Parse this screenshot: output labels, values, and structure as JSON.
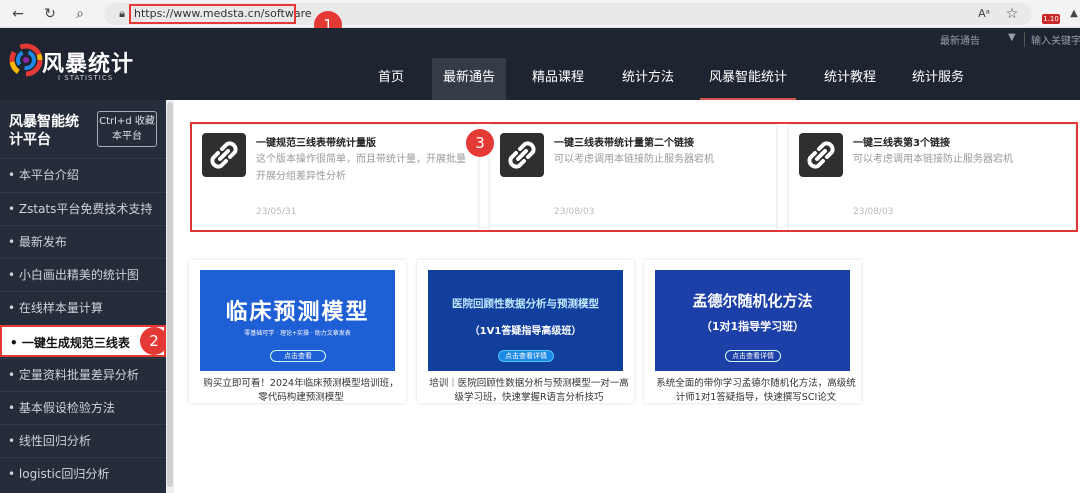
{
  "browser": {
    "url": "https://www.medsta.cn/software",
    "zoom_badge": "1.10"
  },
  "annotations": {
    "m1": "1",
    "m2": "2",
    "m3": "3"
  },
  "site": {
    "logo_text": "风暴统计",
    "logo_sub": "I STATISTICS",
    "top_links": {
      "latest": "最新通告",
      "search_placeholder": "输入关键字"
    },
    "nav": [
      {
        "label": "首页"
      },
      {
        "label": "最新通告"
      },
      {
        "label": "精品课程"
      },
      {
        "label": "统计方法"
      },
      {
        "label": "风暴智能统计"
      },
      {
        "label": "统计教程"
      },
      {
        "label": "统计服务"
      }
    ]
  },
  "sidebar": {
    "title": "风暴智能统计平台",
    "bookmark": "Ctrl+d 收藏本平台",
    "items": [
      {
        "label": "• 本平台介绍"
      },
      {
        "label": "• Zstats平台免费技术支持"
      },
      {
        "label": "• 最新发布"
      },
      {
        "label": "• 小白画出精美的统计图"
      },
      {
        "label": "• 在线样本量计算"
      },
      {
        "label": "• 一键生成规范三线表"
      },
      {
        "label": "• 定量资料批量差异分析"
      },
      {
        "label": "• 基本假设检验方法"
      },
      {
        "label": "• 线性回归分析"
      },
      {
        "label": "• logistic回归分析"
      }
    ]
  },
  "cards": [
    {
      "title": "一键规范三线表带统计量版",
      "desc": "这个版本操作很简单，而且带统计量，开展批量开展分组差异性分析",
      "date": "23/05/31"
    },
    {
      "title": "一键三线表带统计量第二个链接",
      "desc": "可以考虑调用本链接防止服务器宕机",
      "date": "23/08/03"
    },
    {
      "title": "一键三线表第3个链接",
      "desc": "可以考虑调用本链接防止服务器宕机",
      "date": "23/08/03"
    }
  ],
  "courses": [
    {
      "banner_title": "临床预测模型",
      "banner_sub": "零基础可学 · 理论+实操 · 助力文章发表",
      "banner_btn": "点击查看",
      "text": "购买立即可看！2024年临床预测模型培训班，零代码构建预测模型"
    },
    {
      "banner_title": "医院回顾性数据分析与预测模型",
      "banner_sub": "（1V1答疑指导高级班）",
      "banner_btn": "点击查看详情",
      "text": "培训｜医院回顾性数据分析与预测模型一对一高级学习班，快速掌握R语言分析技巧"
    },
    {
      "banner_title": "孟德尔随机化方法",
      "banner_sub": "（1对1指导学习班）",
      "banner_btn": "点击查看详情",
      "text": "系统全面的带你学习孟德尔随机化方法，高级统计师1对1答疑指导，快速撰写SCI论文"
    }
  ]
}
